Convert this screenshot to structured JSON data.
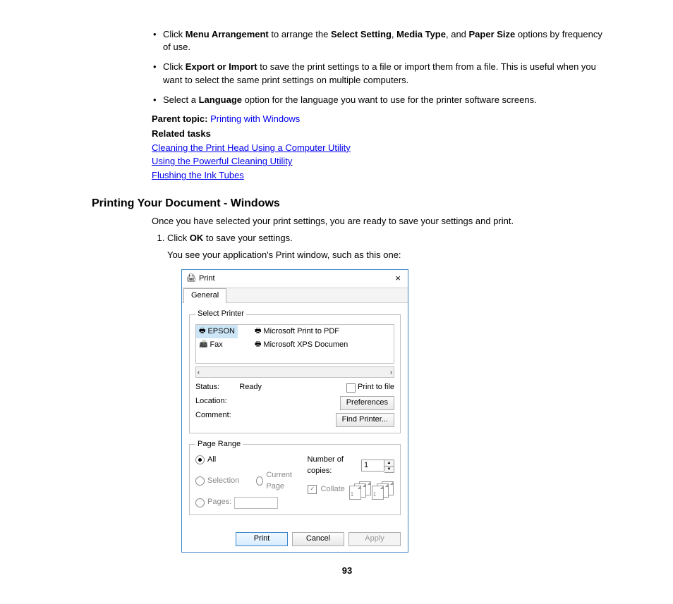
{
  "bullets": [
    {
      "pre": "Click ",
      "b1": "Menu Arrangement",
      "mid1": " to arrange the ",
      "b2": "Select Setting",
      "mid2": ", ",
      "b3": "Media Type",
      "mid3": ", and ",
      "b4": "Paper Size",
      "post": " options by frequency of use."
    },
    {
      "pre": "Click ",
      "b1": "Export or Import",
      "post": " to save the print settings to a file or import them from a file. This is useful when you want to select the same print settings on multiple computers."
    },
    {
      "pre": "Select a ",
      "b1": "Language",
      "post": " option for the language you want to use for the printer software screens."
    }
  ],
  "parentTopicLabel": "Parent topic:",
  "parentTopicLink": "Printing with Windows",
  "relatedTasksLabel": "Related tasks",
  "relatedLinks": [
    "Cleaning the Print Head Using a Computer Utility",
    "Using the Powerful Cleaning Utility",
    "Flushing the Ink Tubes"
  ],
  "sectionTitle": "Printing Your Document - Windows",
  "intro": "Once you have selected your print settings, you are ready to save your settings and print.",
  "step1_pre": "Click ",
  "step1_bold": "OK",
  "step1_post": " to save your settings.",
  "stepNote": "You see your application's Print window, such as this one:",
  "dlg": {
    "title": "Print",
    "tab": "General",
    "selectPrinter": "Select Printer",
    "printers": {
      "p0": "EPSON",
      "p1": "Fax",
      "p2": "Microsoft Print to PDF",
      "p3": "Microsoft XPS Documen"
    },
    "statusLabel": "Status:",
    "statusValue": "Ready",
    "locationLabel": "Location:",
    "commentLabel": "Comment:",
    "printToFile": "Print to file",
    "preferences": "Preferences",
    "findPrinter": "Find Printer...",
    "pageRange": "Page Range",
    "optAll": "All",
    "optSelection": "Selection",
    "optCurrent": "Current Page",
    "optPages": "Pages:",
    "copiesLabel": "Number of copies:",
    "copiesValue": "1",
    "collate": "Collate",
    "btnPrint": "Print",
    "btnCancel": "Cancel",
    "btnApply": "Apply"
  },
  "pageNumber": "93"
}
